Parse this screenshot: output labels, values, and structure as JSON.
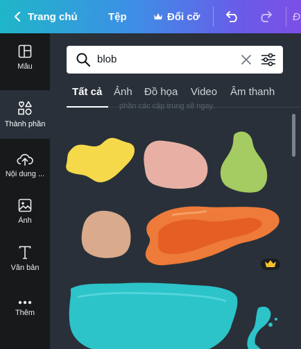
{
  "topbar": {
    "back_label": "Trang chủ",
    "file_label": "Tệp",
    "resize_label": "Đổi cỡ",
    "extra_label": "Đ",
    "icons": [
      "chevron-left-icon",
      "crown-icon",
      "undo-icon",
      "redo-icon"
    ]
  },
  "sidebar": {
    "items": [
      {
        "label": "Mẫu",
        "icon": "template-icon"
      },
      {
        "label": "Thành phần",
        "icon": "elements-icon"
      },
      {
        "label": "Nội dung ...",
        "icon": "upload-icon"
      },
      {
        "label": "Ảnh",
        "icon": "photo-icon"
      },
      {
        "label": "Văn bản",
        "icon": "text-icon"
      },
      {
        "label": "Thêm",
        "icon": "more-icon"
      }
    ],
    "active": "Thành phần"
  },
  "search": {
    "value": "blob",
    "icons": [
      "search-icon",
      "clear-icon",
      "filter-icon"
    ]
  },
  "tabs": [
    "Tất cả",
    "Ảnh",
    "Đồ họa",
    "Video",
    "Âm thanh"
  ],
  "active_tab": "Tất cả",
  "ghost_text": "phần các cập trung sẽ ngay.",
  "results": [
    {
      "name": "yellow-blob",
      "color": "#f5d94a"
    },
    {
      "name": "pink-blob",
      "color": "#e8b0a4"
    },
    {
      "name": "green-blob",
      "color": "#a4cc62"
    },
    {
      "name": "tan-blob",
      "color": "#d9aa8b"
    },
    {
      "name": "orange-watercolor-blob",
      "color": "#ec6f28",
      "premium": true
    },
    {
      "name": "teal-paint-stroke",
      "color": "#27c0c7"
    }
  ],
  "premium_icon": "crown-icon",
  "colors": {
    "accent_start": "#1fb6c9",
    "accent_end": "#7d4fe6",
    "sidebar_bg": "#18191b",
    "panel_bg": "#293039"
  }
}
